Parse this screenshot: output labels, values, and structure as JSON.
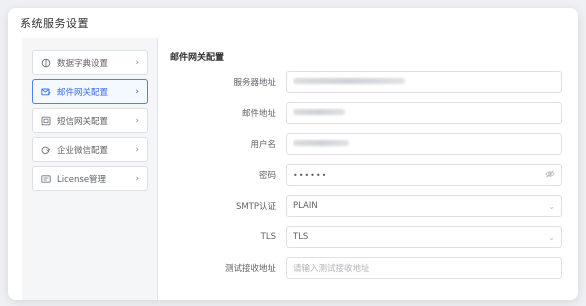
{
  "window": {
    "title": "系统服务设置"
  },
  "sidebar": {
    "items": [
      {
        "label": "数据字典设置",
        "icon": "dictionary-icon",
        "active": false
      },
      {
        "label": "邮件网关配置",
        "icon": "mail-edit-icon",
        "active": true
      },
      {
        "label": "短信网关配置",
        "icon": "sms-icon",
        "active": false
      },
      {
        "label": "企业微信配置",
        "icon": "wechat-icon",
        "active": false
      },
      {
        "label": "License管理",
        "icon": "license-icon",
        "active": false
      }
    ]
  },
  "panel": {
    "title": "邮件网关配置",
    "fields": {
      "server": {
        "label": "服务器地址"
      },
      "mail": {
        "label": "邮件地址"
      },
      "username": {
        "label": "用户名"
      },
      "password": {
        "label": "密码",
        "value": "••••••"
      },
      "smtp_auth": {
        "label": "SMTP认证",
        "value": "PLAIN"
      },
      "tls": {
        "label": "TLS",
        "value": "TLS"
      },
      "test_address": {
        "label": "测试接收地址",
        "placeholder": "请输入测试接收地址"
      }
    }
  },
  "colors": {
    "accent": "#3a6cf2",
    "border": "#dcdfe6",
    "muted": "#606266"
  }
}
